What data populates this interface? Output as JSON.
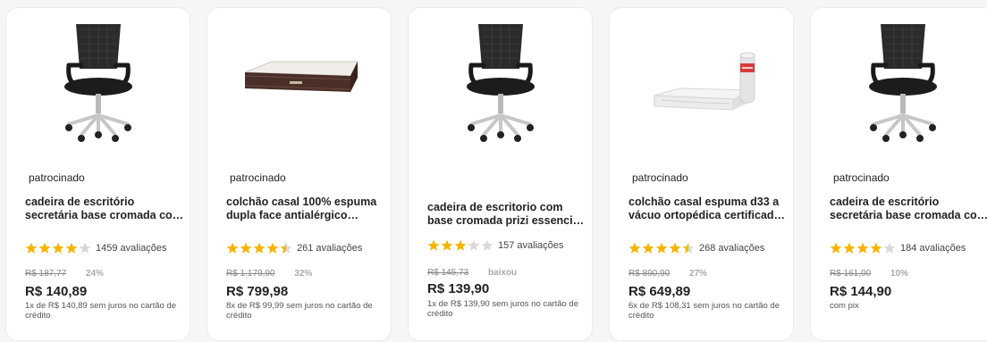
{
  "colors": {
    "star": "#f5b400",
    "star_empty": "#d9d9d9"
  },
  "products": [
    {
      "badge": "patrocinado",
      "image_icon": "office-chair-icon",
      "title": "cadeira de escritório\nsecretária base cromada co…",
      "rating": 4,
      "reviews": "1459 avaliações",
      "old_price": "R$ 187,77",
      "discount": "24%",
      "price": "R$ 140,89",
      "installments": "1x de R$ 140,89 sem juros no cartão de crédito"
    },
    {
      "badge": "patrocinado",
      "image_icon": "mattress-icon",
      "title": "colchão casal 100% espuma\ndupla face antialérgico…",
      "rating": 4.5,
      "reviews": "261 avaliações",
      "old_price": "R$ 1.179,90",
      "discount": "32%",
      "price": "R$ 799,98",
      "installments": "8x de R$ 99,99 sem juros no cartão de crédito"
    },
    {
      "badge": "",
      "image_icon": "office-chair-icon",
      "title": "cadeira de escritorio com\nbase cromada prizi essenci…",
      "rating": 3,
      "reviews": "157 avaliações",
      "old_price": "R$ 145,73",
      "discount": "baixou",
      "price": "R$ 139,90",
      "installments": "1x de R$ 139,90 sem juros no cartão de crédito"
    },
    {
      "badge": "patrocinado",
      "image_icon": "vacuum-mattress-icon",
      "title": "colchão casal espuma d33 a\nvácuo ortopédica certificad…",
      "rating": 4.5,
      "reviews": "268 avaliações",
      "old_price": "R$ 890,90",
      "discount": "27%",
      "price": "R$ 649,89",
      "installments": "6x de R$ 108,31 sem juros no cartão de crédito"
    },
    {
      "badge": "patrocinado",
      "image_icon": "office-chair-icon",
      "title": "cadeira de escritório\nsecretária base cromada co…",
      "rating": 4,
      "reviews": "184 avaliações",
      "old_price": "R$ 161,00",
      "discount": "10%",
      "price": "R$ 144,90",
      "installments": "com pix"
    }
  ]
}
